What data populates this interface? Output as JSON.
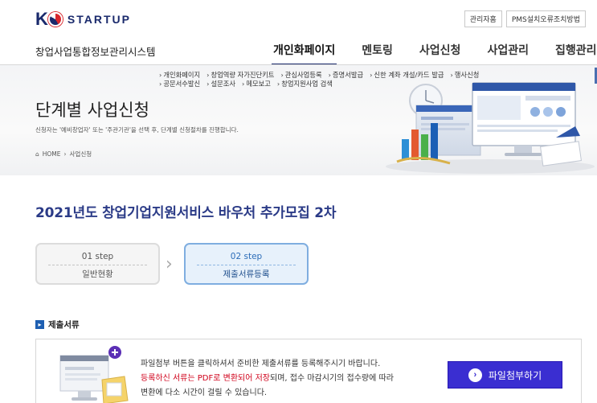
{
  "header": {
    "logo_letter": "K",
    "logo_text": "STARTUP",
    "site_name": "창업사업통합정보관리시스템",
    "top_links": [
      "관리자홈",
      "PMS설치오류조치방법"
    ]
  },
  "gnb": {
    "items": [
      "개인화페이지",
      "멘토링",
      "사업신청",
      "사업관리",
      "집행관리"
    ],
    "active_index": 0
  },
  "banner": {
    "sub_links_row1": [
      "개인화페이지",
      "창업역량 자가진단키트",
      "관심사업등록",
      "증명서발급",
      "신한 계좌 개설/카드 발급",
      "행사신청"
    ],
    "sub_links_row2": [
      "공문서수발신",
      "설문조사",
      "메모보고",
      "창업지원사업 검색"
    ],
    "title": "단계별 사업신청",
    "description": "신청자는 '예비창업자' 또는 '주관기관'을 선택 후, 단계별 신청절차를 진행합니다.",
    "breadcrumb": [
      "HOME",
      "사업신청"
    ]
  },
  "notice": {
    "title": "2021년도 창업기업지원서비스 바우처 추가모집 2차"
  },
  "steps": [
    {
      "number": "01 step",
      "label": "일반현황",
      "active": false
    },
    {
      "number": "02 step",
      "label": "제출서류등록",
      "active": true
    }
  ],
  "section": {
    "label": "제출서류"
  },
  "upload": {
    "line1": "파일첨부 버튼을 클릭하셔서 준비한 제출서류를 등록해주시기 바랍니다.",
    "line2_red": "등록하신 서류는 PDF로 변환되어 저장",
    "line2_rest": "되며, 접수 마감시기의 접수량에 따라",
    "line3": "변환에 다소 시간이 걸릴 수 있습니다.",
    "button_label": "파일첨부하기"
  },
  "colors": {
    "brand_navy": "#1a2a6c",
    "brand_red": "#d7262c",
    "title_blue": "#2b3b87",
    "button_purple": "#3a2ed1",
    "highlight_red": "#d0021b"
  }
}
